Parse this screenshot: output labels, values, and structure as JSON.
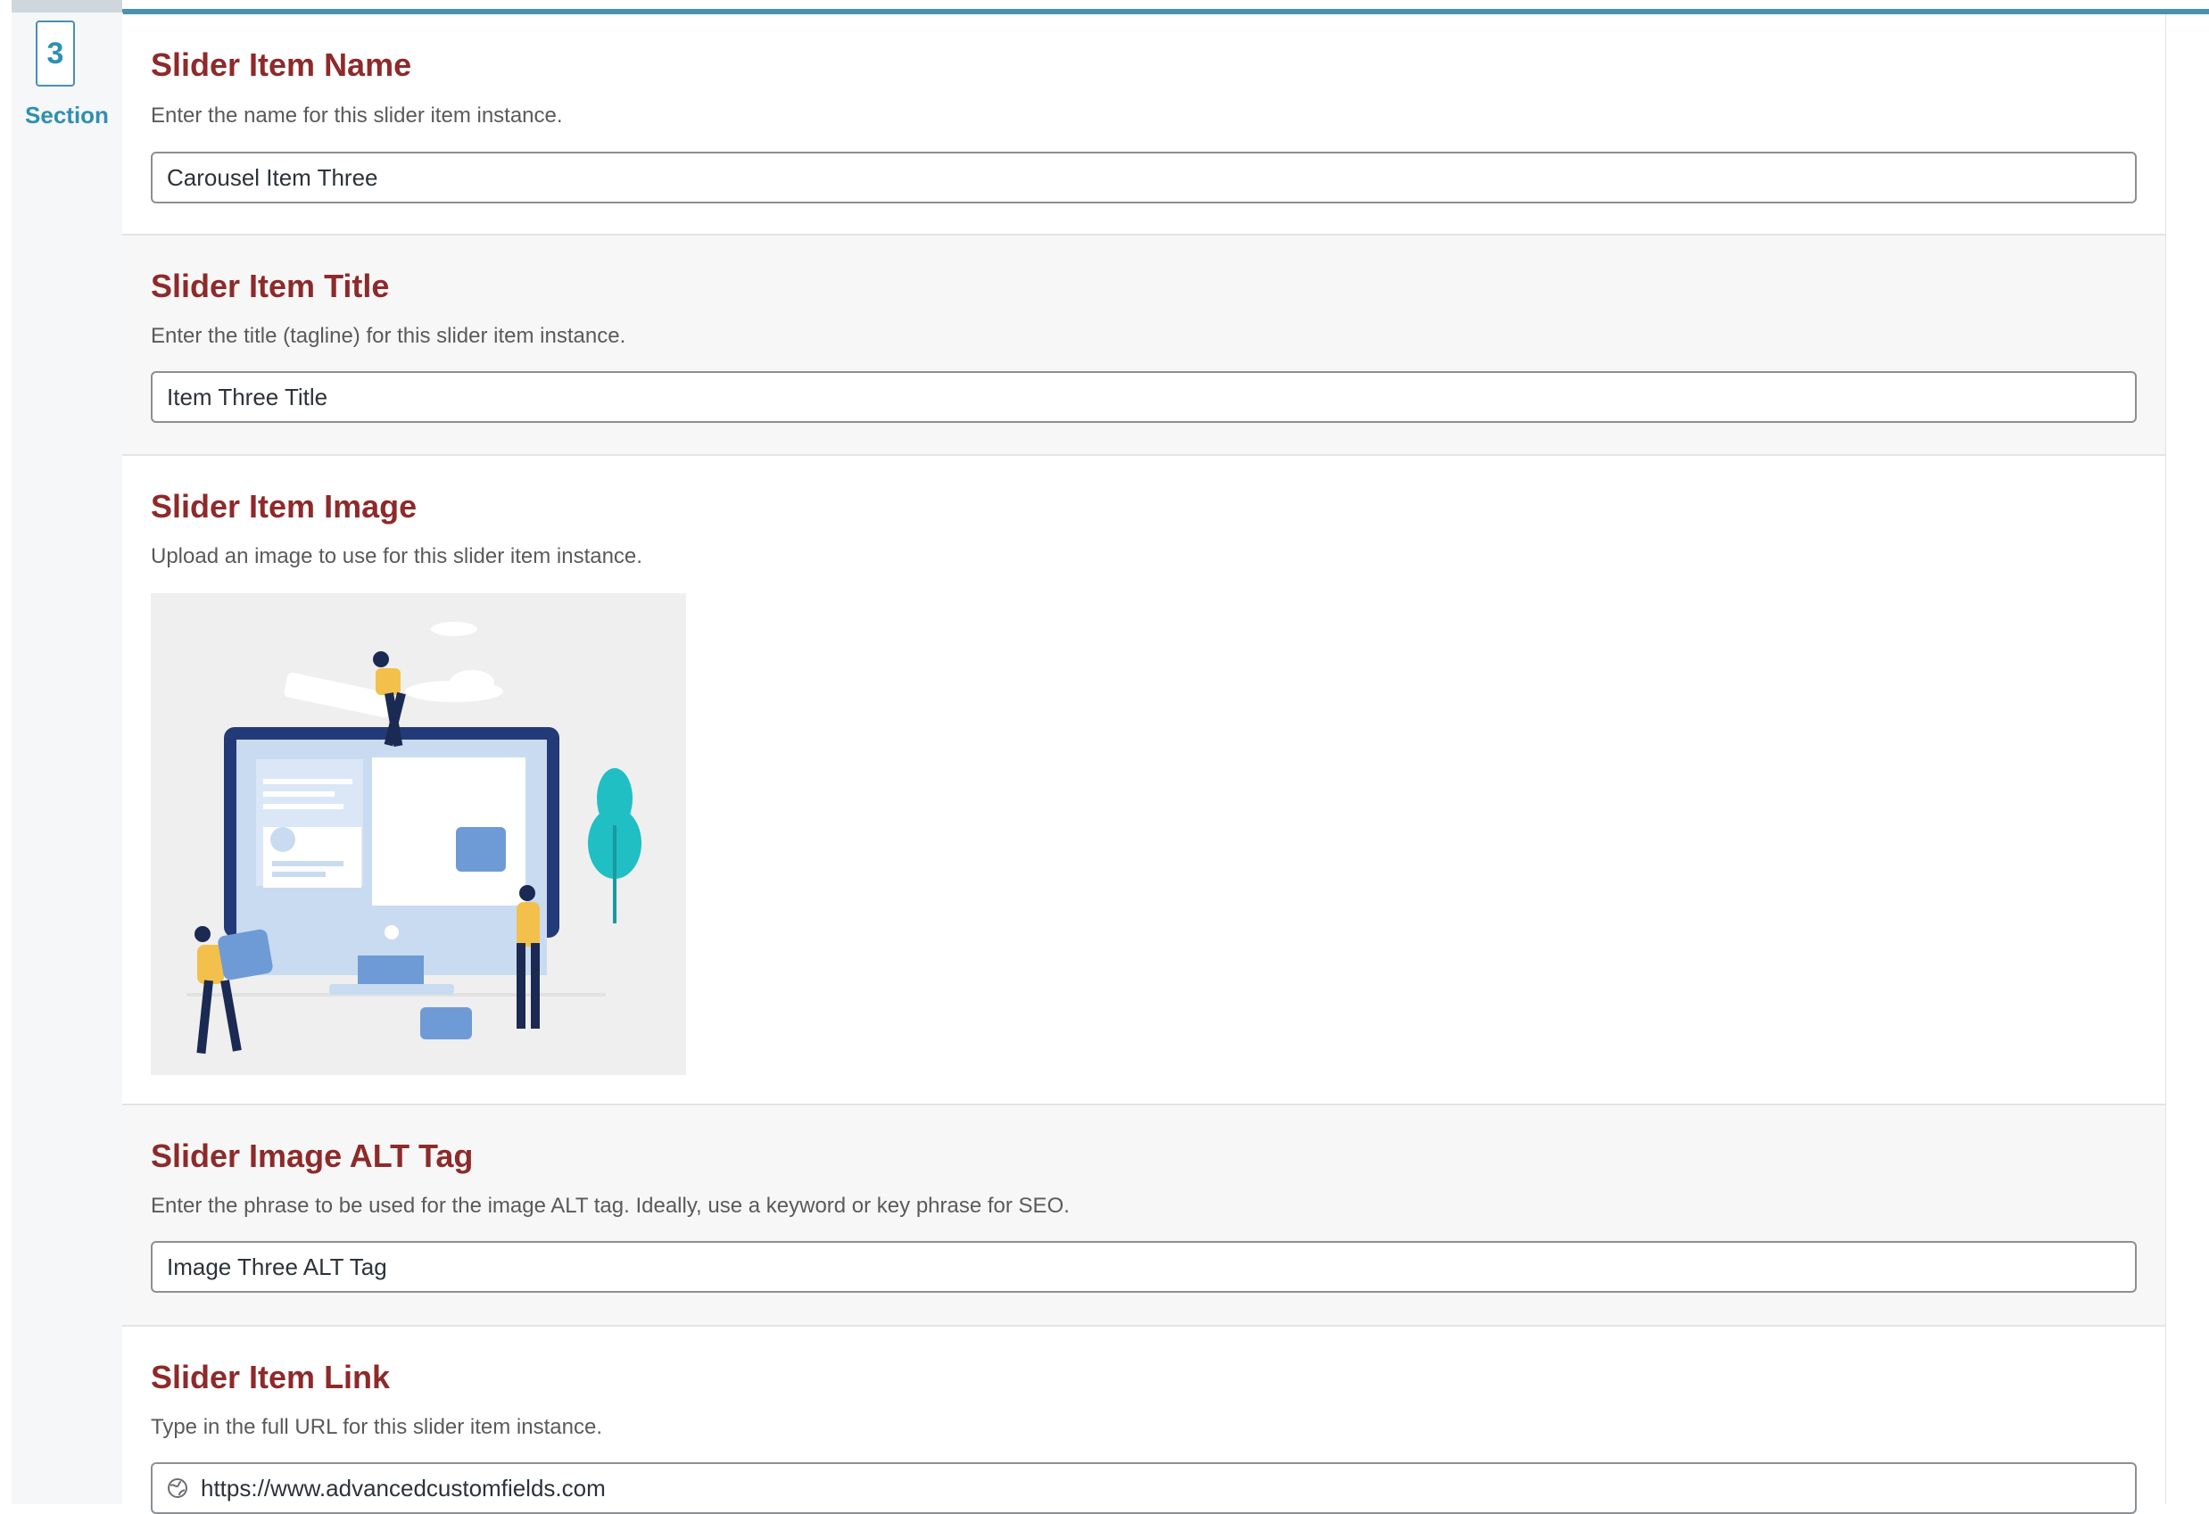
{
  "row": {
    "order_number": "3",
    "order_label": "Section"
  },
  "fields": {
    "name": {
      "label": "Slider Item Name",
      "description": "Enter the name for this slider item instance.",
      "value": "Carousel Item Three"
    },
    "title": {
      "label": "Slider Item Title",
      "description": "Enter the title (tagline) for this slider item instance.",
      "value": "Item Three Title"
    },
    "image": {
      "label": "Slider Item Image",
      "description": "Upload an image to use for this slider item instance."
    },
    "alt": {
      "label": "Slider Image ALT Tag",
      "description": "Enter the phrase to be used for the image ALT tag. Ideally, use a keyword or key phrase for SEO.",
      "value": "Image Three ALT Tag"
    },
    "link": {
      "label": "Slider Item Link",
      "description": "Type in the full URL for this slider item instance.",
      "value": "https://www.advancedcustomfields.com",
      "icon": "globe-icon"
    }
  },
  "colors": {
    "label": "#8e2a2a",
    "accent": "#2f8fb3",
    "top_bar": "#4a90b0"
  }
}
